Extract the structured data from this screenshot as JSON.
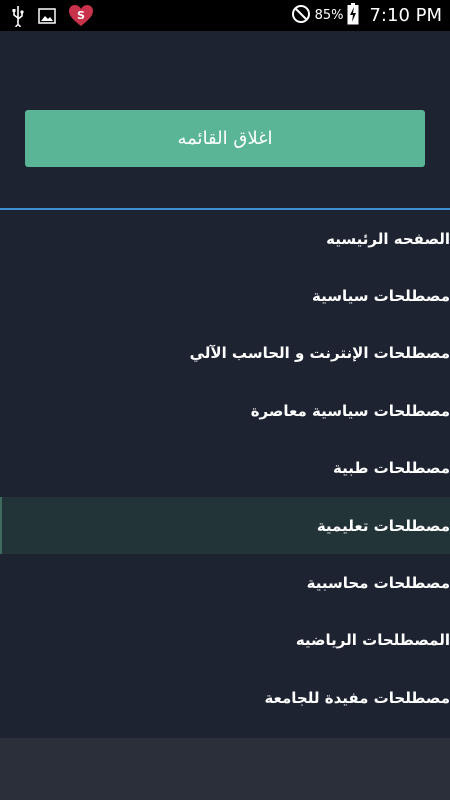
{
  "status_bar": {
    "battery_percent": "85%",
    "time": "7:10 PM",
    "icons": [
      "usb-icon",
      "image-icon",
      "heart-app-icon",
      "do-not-disturb-icon",
      "battery-charging-icon"
    ]
  },
  "drawer": {
    "close_button_label": "اغلاق القائمه",
    "divider_color": "#3f8fd2",
    "accent_color": "#5ab596",
    "menu_items": [
      {
        "label": "الصفحه الرئيسيه"
      },
      {
        "label": "مصطلحات سياسية"
      },
      {
        "label": "مصطلحات الإنترنت و الحاسب الآلي"
      },
      {
        "label": "مصطلحات سياسية معاصرة"
      },
      {
        "label": "مصطلحات طبية"
      },
      {
        "label": "مصطلحات تعليمية",
        "selected": true
      },
      {
        "label": "مصطلحات محاسبية"
      },
      {
        "label": "المصطلحات الرياضيه"
      },
      {
        "label": "مصطلحات مفيدة للجامعة"
      }
    ]
  }
}
